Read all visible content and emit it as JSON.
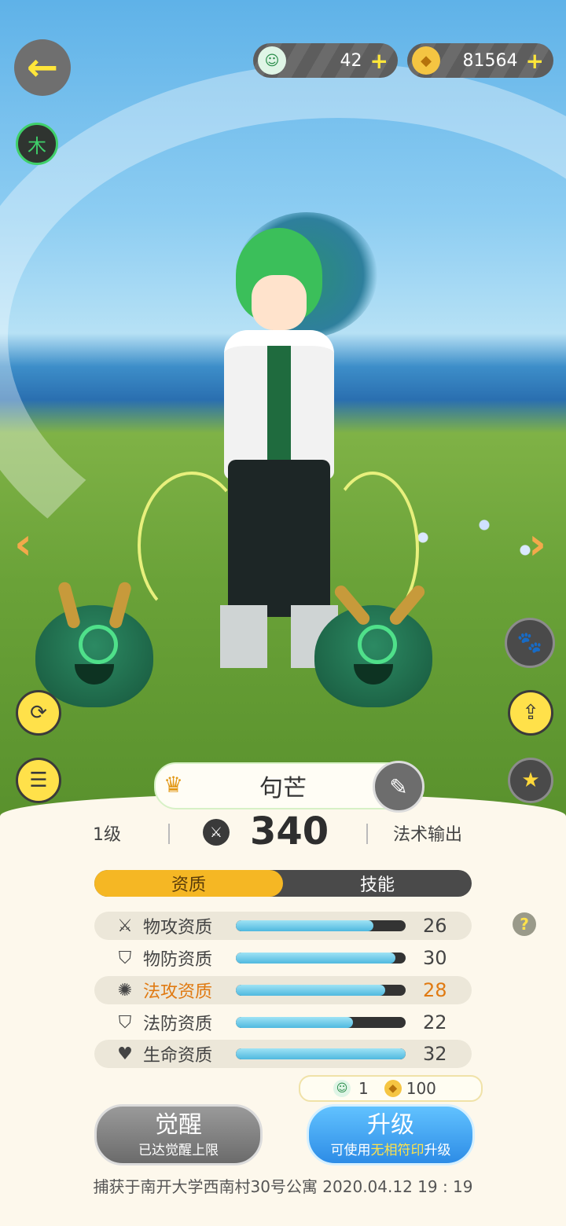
{
  "top_bar": {
    "back_icon": "arrow-left-icon",
    "element_badge": "木",
    "currency_1": {
      "icon": "pet-token-icon",
      "value": "42",
      "plus": "+"
    },
    "currency_2": {
      "icon": "crystal-icon",
      "value": "81564",
      "plus": "+"
    }
  },
  "nav": {
    "prev": "‹",
    "next": "›"
  },
  "pet": {
    "name": "句芒",
    "level": "1级",
    "power": "340",
    "role": "法术输出"
  },
  "tabs": [
    {
      "label": "资质",
      "active": true
    },
    {
      "label": "技能",
      "active": false
    }
  ],
  "stats": [
    {
      "label": "物攻资质",
      "value": "26",
      "fill": 0.81,
      "icon": "swords-icon"
    },
    {
      "label": "物防资质",
      "value": "30",
      "fill": 0.94,
      "icon": "shield-icon"
    },
    {
      "label": "法攻资质",
      "value": "28",
      "fill": 0.88,
      "icon": "magic-icon",
      "highlight": true
    },
    {
      "label": "法防资质",
      "value": "22",
      "fill": 0.69,
      "icon": "shield-icon"
    },
    {
      "label": "生命资质",
      "value": "32",
      "fill": 1.0,
      "icon": "heart-icon"
    }
  ],
  "help": "?",
  "cost": {
    "item_1_count": "1",
    "item_2_count": "100"
  },
  "buttons": {
    "awaken": {
      "label": "觉醒",
      "sub": "已达觉醒上限"
    },
    "upgrade": {
      "label": "升级",
      "sub_prefix": "可使用",
      "sub_highlight": "无相符印",
      "sub_suffix": "升级"
    }
  },
  "footer": "捕获于南开大学西南村30号公寓  2020.04.12   19 : 19"
}
